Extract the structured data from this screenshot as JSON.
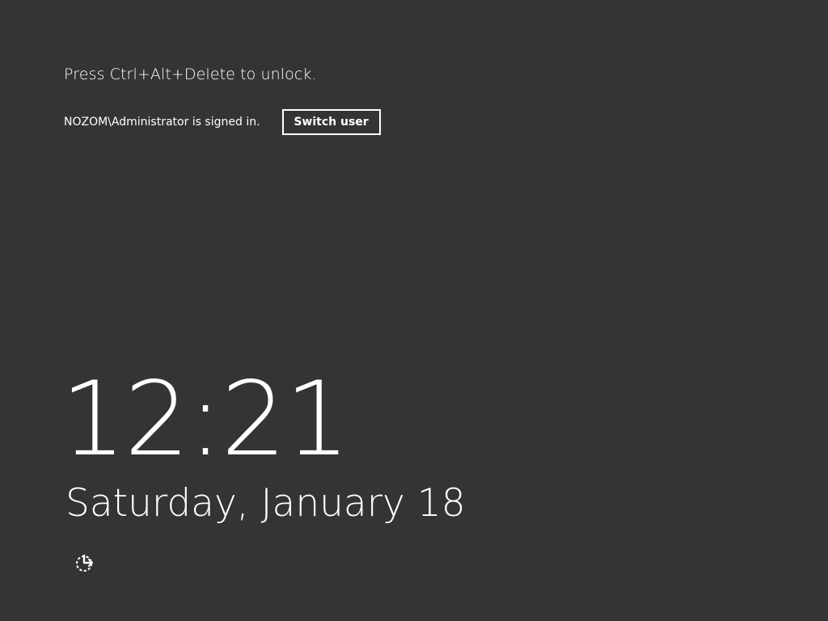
{
  "lock_screen": {
    "prompt": "Press Ctrl+Alt+Delete to unlock.",
    "signed_in_message": "NOZOM\\Administrator is signed in.",
    "switch_user_label": "Switch user",
    "time": "12:21",
    "date": "Saturday, January 18",
    "accessibility_icon": "ease-of-access-icon"
  },
  "colors": {
    "background": "#343434",
    "text": "#ffffff"
  }
}
